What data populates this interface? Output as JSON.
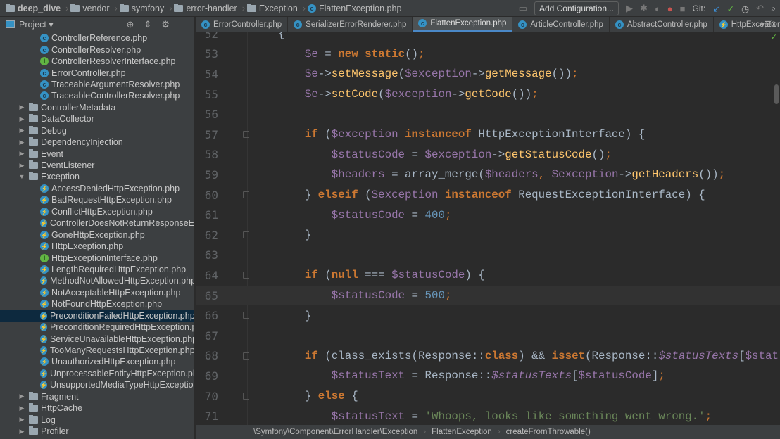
{
  "breadcrumb": [
    "deep_dive",
    "vendor",
    "symfony",
    "error-handler",
    "Exception"
  ],
  "breadcrumb_file": "FlattenException.php",
  "toolbar": {
    "add_configuration": "Add Configuration...",
    "git_label": "Git:"
  },
  "project": {
    "label": "Project ▾"
  },
  "tree": [
    {
      "label": "ControllerReference.php",
      "type": "class",
      "depth": 2
    },
    {
      "label": "ControllerResolver.php",
      "type": "class",
      "depth": 2
    },
    {
      "label": "ControllerResolverInterface.php",
      "type": "interface",
      "depth": 2
    },
    {
      "label": "ErrorController.php",
      "type": "class",
      "depth": 2
    },
    {
      "label": "TraceableArgumentResolver.php",
      "type": "class",
      "depth": 2
    },
    {
      "label": "TraceableControllerResolver.php",
      "type": "class",
      "depth": 2
    },
    {
      "label": "ControllerMetadata",
      "type": "folder",
      "depth": 1
    },
    {
      "label": "DataCollector",
      "type": "folder",
      "depth": 1
    },
    {
      "label": "Debug",
      "type": "folder",
      "depth": 1
    },
    {
      "label": "DependencyInjection",
      "type": "folder",
      "depth": 1
    },
    {
      "label": "Event",
      "type": "folder",
      "depth": 1
    },
    {
      "label": "EventListener",
      "type": "folder",
      "depth": 1
    },
    {
      "label": "Exception",
      "type": "folder-open",
      "depth": 1
    },
    {
      "label": "AccessDeniedHttpException.php",
      "type": "exception",
      "depth": 2
    },
    {
      "label": "BadRequestHttpException.php",
      "type": "exception",
      "depth": 2
    },
    {
      "label": "ConflictHttpException.php",
      "type": "exception",
      "depth": 2
    },
    {
      "label": "ControllerDoesNotReturnResponseEx",
      "type": "exception",
      "depth": 2
    },
    {
      "label": "GoneHttpException.php",
      "type": "exception",
      "depth": 2
    },
    {
      "label": "HttpException.php",
      "type": "exception",
      "depth": 2
    },
    {
      "label": "HttpExceptionInterface.php",
      "type": "interface",
      "depth": 2
    },
    {
      "label": "LengthRequiredHttpException.php",
      "type": "exception",
      "depth": 2
    },
    {
      "label": "MethodNotAllowedHttpException.php",
      "type": "exception",
      "depth": 2
    },
    {
      "label": "NotAcceptableHttpException.php",
      "type": "exception",
      "depth": 2
    },
    {
      "label": "NotFoundHttpException.php",
      "type": "exception",
      "depth": 2
    },
    {
      "label": "PreconditionFailedHttpException.php",
      "type": "exception",
      "depth": 2,
      "selected": true
    },
    {
      "label": "PreconditionRequiredHttpException.p",
      "type": "exception",
      "depth": 2
    },
    {
      "label": "ServiceUnavailableHttpException.php",
      "type": "exception",
      "depth": 2
    },
    {
      "label": "TooManyRequestsHttpException.php",
      "type": "exception",
      "depth": 2
    },
    {
      "label": "UnauthorizedHttpException.php",
      "type": "exception",
      "depth": 2
    },
    {
      "label": "UnprocessableEntityHttpException.ph",
      "type": "exception",
      "depth": 2
    },
    {
      "label": "UnsupportedMediaTypeHttpExceptior",
      "type": "exception",
      "depth": 2
    },
    {
      "label": "Fragment",
      "type": "folder",
      "depth": 1
    },
    {
      "label": "HttpCache",
      "type": "folder",
      "depth": 1
    },
    {
      "label": "Log",
      "type": "folder",
      "depth": 1
    },
    {
      "label": "Profiler",
      "type": "folder",
      "depth": 1
    }
  ],
  "tabs": [
    {
      "label": "ErrorController.php"
    },
    {
      "label": "SerializerErrorRenderer.php"
    },
    {
      "label": "FlattenException.php",
      "active": true
    },
    {
      "label": "ArticleController.php"
    },
    {
      "label": "AbstractController.php"
    },
    {
      "label": "HttpException.php"
    }
  ],
  "tabs_overflow": "3",
  "code": [
    {
      "n": "52",
      "t": [
        [
          "    {",
          ""
        ]
      ]
    },
    {
      "n": "53",
      "t": [
        [
          "        ",
          ""
        ],
        [
          "$e",
          "var"
        ],
        [
          " = ",
          ""
        ],
        [
          "new static",
          "kw"
        ],
        [
          "()",
          ""
        ],
        [
          ";",
          "pn"
        ]
      ]
    },
    {
      "n": "54",
      "t": [
        [
          "        ",
          ""
        ],
        [
          "$e",
          "var"
        ],
        [
          "->",
          ""
        ],
        [
          "setMessage",
          "fn"
        ],
        [
          "(",
          ""
        ],
        [
          "$exception",
          "var"
        ],
        [
          "->",
          ""
        ],
        [
          "getMessage",
          "fn"
        ],
        [
          "())",
          ""
        ],
        [
          ";",
          "pn"
        ]
      ]
    },
    {
      "n": "55",
      "t": [
        [
          "        ",
          ""
        ],
        [
          "$e",
          "var"
        ],
        [
          "->",
          ""
        ],
        [
          "setCode",
          "fn"
        ],
        [
          "(",
          ""
        ],
        [
          "$exception",
          "var"
        ],
        [
          "->",
          ""
        ],
        [
          "getCode",
          "fn"
        ],
        [
          "())",
          ""
        ],
        [
          ";",
          "pn"
        ]
      ]
    },
    {
      "n": "56",
      "t": []
    },
    {
      "n": "57",
      "t": [
        [
          "        ",
          ""
        ],
        [
          "if",
          "kw"
        ],
        [
          " (",
          ""
        ],
        [
          "$exception",
          "var"
        ],
        [
          " ",
          ""
        ],
        [
          "instanceof",
          "kw"
        ],
        [
          " HttpExceptionInterface) {",
          ""
        ]
      ],
      "fold": true
    },
    {
      "n": "58",
      "t": [
        [
          "            ",
          ""
        ],
        [
          "$statusCode",
          "var"
        ],
        [
          " = ",
          ""
        ],
        [
          "$exception",
          "var"
        ],
        [
          "->",
          ""
        ],
        [
          "getStatusCode",
          "fn"
        ],
        [
          "()",
          ""
        ],
        [
          ";",
          "pn"
        ]
      ]
    },
    {
      "n": "59",
      "t": [
        [
          "            ",
          ""
        ],
        [
          "$headers",
          "var"
        ],
        [
          " = array_merge(",
          ""
        ],
        [
          "$headers",
          "var"
        ],
        [
          ", ",
          "pn"
        ],
        [
          "$exception",
          "var"
        ],
        [
          "->",
          ""
        ],
        [
          "getHeaders",
          "fn"
        ],
        [
          "())",
          ""
        ],
        [
          ";",
          "pn"
        ]
      ]
    },
    {
      "n": "60",
      "t": [
        [
          "        } ",
          ""
        ],
        [
          "elseif",
          "kw"
        ],
        [
          " (",
          ""
        ],
        [
          "$exception",
          "var"
        ],
        [
          " ",
          ""
        ],
        [
          "instanceof",
          "kw"
        ],
        [
          " RequestExceptionInterface) {",
          ""
        ]
      ],
      "fold": true
    },
    {
      "n": "61",
      "t": [
        [
          "            ",
          ""
        ],
        [
          "$statusCode",
          "var"
        ],
        [
          " = ",
          ""
        ],
        [
          "400",
          "num"
        ],
        [
          ";",
          "pn"
        ]
      ]
    },
    {
      "n": "62",
      "t": [
        [
          "        }",
          ""
        ]
      ],
      "fold": true
    },
    {
      "n": "63",
      "t": []
    },
    {
      "n": "64",
      "t": [
        [
          "        ",
          ""
        ],
        [
          "if",
          "kw"
        ],
        [
          " (",
          ""
        ],
        [
          "null",
          "kw"
        ],
        [
          " === ",
          ""
        ],
        [
          "$statusCode",
          "var"
        ],
        [
          ") {",
          ""
        ]
      ],
      "fold": true
    },
    {
      "n": "65",
      "t": [
        [
          "            ",
          ""
        ],
        [
          "$statusCode",
          "var"
        ],
        [
          " = ",
          ""
        ],
        [
          "500",
          "num"
        ],
        [
          ";",
          "pn"
        ]
      ],
      "current": true
    },
    {
      "n": "66",
      "t": [
        [
          "        }",
          ""
        ]
      ],
      "fold": true
    },
    {
      "n": "67",
      "t": []
    },
    {
      "n": "68",
      "t": [
        [
          "        ",
          ""
        ],
        [
          "if",
          "kw"
        ],
        [
          " (class_exists(Response::",
          ""
        ],
        [
          "class",
          "kw"
        ],
        [
          ") && ",
          ""
        ],
        [
          "isset",
          "kw"
        ],
        [
          "(Response::",
          ""
        ],
        [
          "$statusTexts",
          "st"
        ],
        [
          "[",
          ""
        ],
        [
          "$stat",
          "var"
        ]
      ],
      "fold": true
    },
    {
      "n": "69",
      "t": [
        [
          "            ",
          ""
        ],
        [
          "$statusText",
          "var"
        ],
        [
          " = Response::",
          ""
        ],
        [
          "$statusTexts",
          "st"
        ],
        [
          "[",
          ""
        ],
        [
          "$statusCode",
          "var"
        ],
        [
          "]",
          ""
        ],
        [
          ";",
          "pn"
        ]
      ]
    },
    {
      "n": "70",
      "t": [
        [
          "        } ",
          ""
        ],
        [
          "else",
          "kw"
        ],
        [
          " {",
          ""
        ]
      ],
      "fold": true
    },
    {
      "n": "71",
      "t": [
        [
          "            ",
          ""
        ],
        [
          "$statusText",
          "var"
        ],
        [
          " = ",
          ""
        ],
        [
          "'Whoops, looks like something went wrong.'",
          "str"
        ],
        [
          ";",
          "pn"
        ]
      ]
    }
  ],
  "status_path": [
    "\\Symfony\\Component\\ErrorHandler\\Exception",
    "FlattenException",
    "createFromThrowable()"
  ]
}
